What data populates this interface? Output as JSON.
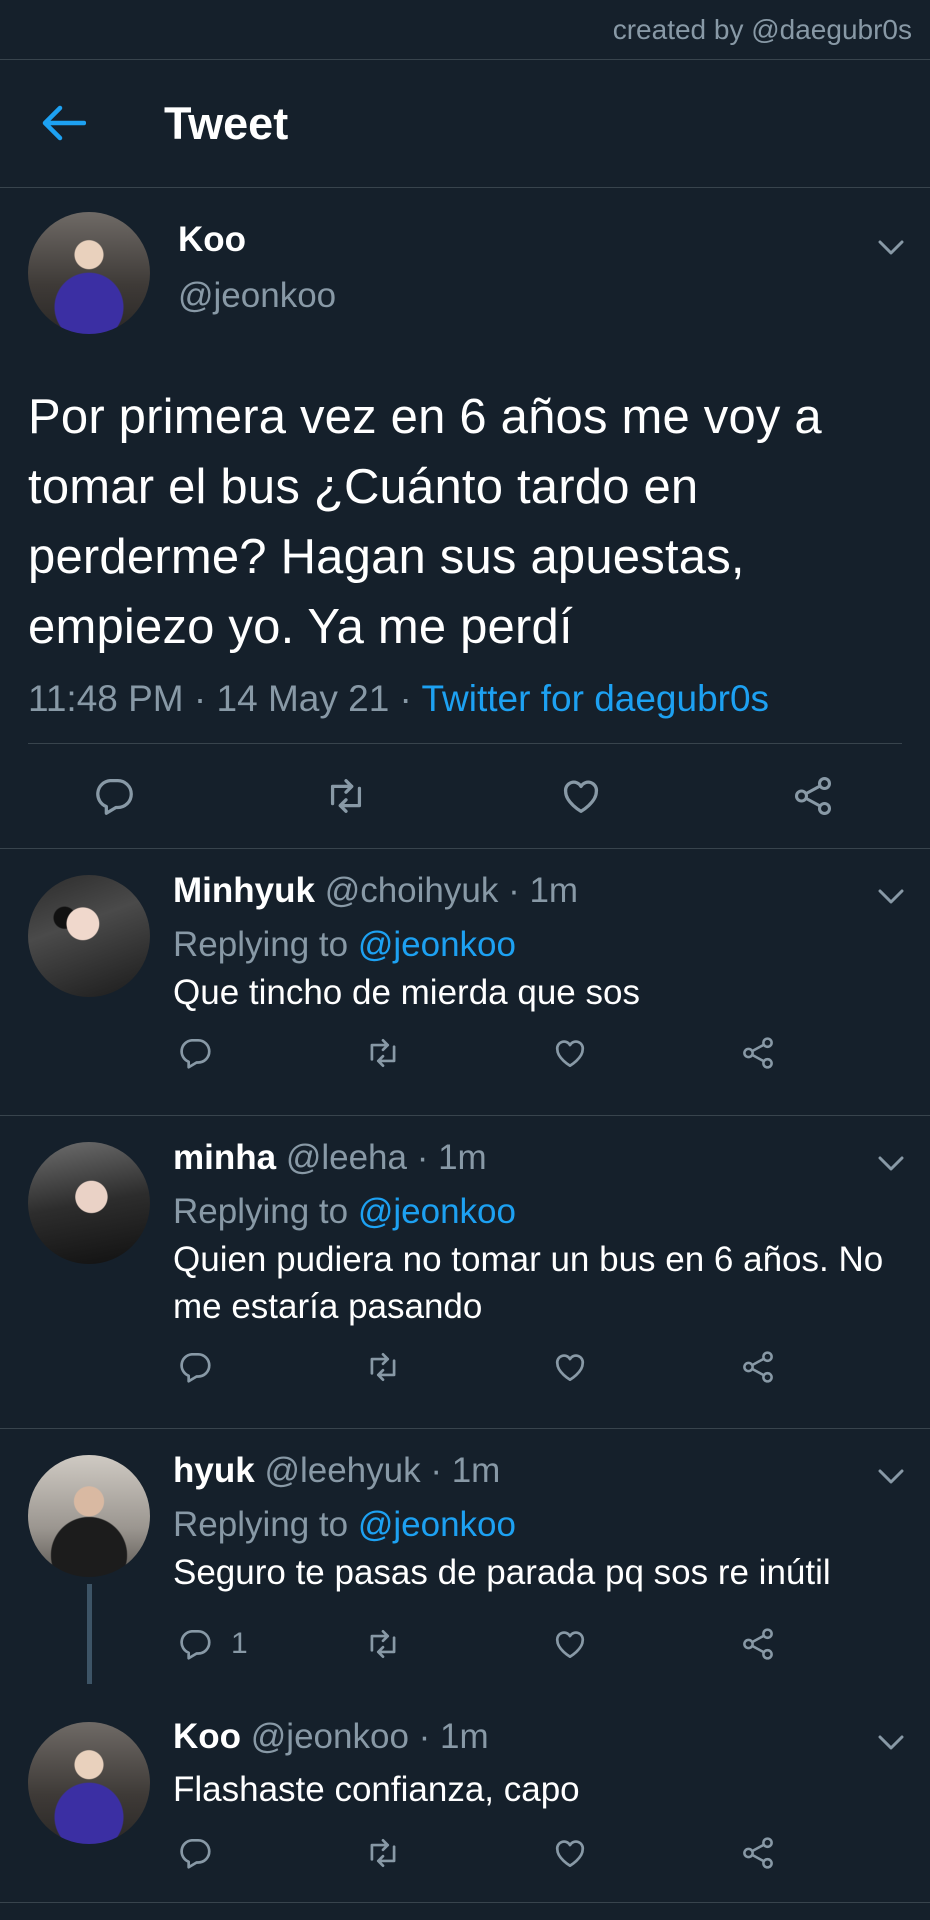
{
  "credit": "created by @daegubr0s",
  "header": {
    "title": "Tweet"
  },
  "main_tweet": {
    "name": "Koo",
    "handle": "@jeonkoo",
    "text": "Por primera vez en 6 años me voy a tomar el bus ¿Cuánto tardo en perderme? Hagan sus apuestas, empiezo yo. Ya me perdí",
    "time": "11:48 PM · 14 May 21 · ",
    "source": "Twitter for daegubr0s"
  },
  "replies": [
    {
      "name": "Minhyuk",
      "handle": "@choihyuk",
      "time": " · 1m",
      "replying_prefix": "Replying to ",
      "replying_to": "@jeonkoo",
      "text": "Que tincho de mierda que sos",
      "reply_count": ""
    },
    {
      "name": "minha",
      "handle": "@leeha",
      "time": " · 1m",
      "replying_prefix": "Replying to ",
      "replying_to": "@jeonkoo",
      "text": "Quien pudiera no tomar un bus en 6 años. No me estaría pasando",
      "reply_count": ""
    },
    {
      "name": "hyuk",
      "handle": "@leehyuk",
      "time": " · 1m",
      "replying_prefix": "Replying to ",
      "replying_to": "@jeonkoo",
      "text": "Seguro te pasas de parada pq sos re inútil",
      "reply_count": "1"
    },
    {
      "name": "Koo",
      "handle": "@jeonkoo",
      "time": " · 1m",
      "text": "Flashaste confianza, capo",
      "reply_count": ""
    }
  ],
  "icons": {
    "back": "arrow-left-icon",
    "more": "chevron-down-icon",
    "reply": "speech-bubble-icon",
    "retweet": "retweet-icon",
    "like": "heart-icon",
    "share": "share-icon"
  },
  "colors": {
    "background": "#15202b",
    "accent": "#1da1f2",
    "muted": "#8899a6",
    "divider": "#38444d"
  }
}
